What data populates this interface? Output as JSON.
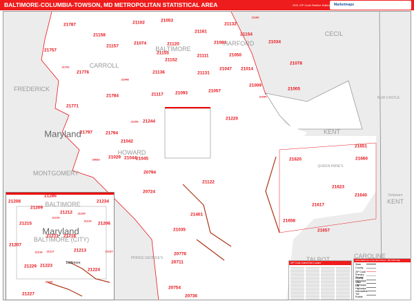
{
  "header": {
    "title": "BALTIMORE-COLUMBIA-TOWSON, MD METROPOLITAN STATISTICAL AREA",
    "edition": "2021 ZIP Code Redline Edition",
    "logo": "Marketmaps"
  },
  "colors": {
    "header": "#ee1c1c",
    "zip": "#e8141b",
    "outside_land": "#ececec"
  },
  "regions": [
    "CARROLL",
    "BALTIMORE",
    "HARFORD",
    "FREDERICK",
    "CECIL",
    "Maryland",
    "MONTGOMERY",
    "HOWARD",
    "KENT",
    "QUEEN ANNE'S",
    "NEW CASTLE",
    "Delaware",
    "KENT",
    "PRINCE GEORGE'S",
    "TALBOT",
    "CAROLINE"
  ],
  "zips": [
    "21787",
    "21158",
    "21102",
    "21053",
    "21161",
    "21132",
    "21160",
    "21154",
    "21757",
    "21157",
    "21074",
    "21120",
    "21084",
    "21034",
    "21155",
    "21152",
    "21111",
    "21050",
    "21791",
    "21776",
    "21136",
    "21131",
    "21047",
    "21014",
    "21078",
    "21048",
    "21784",
    "21117",
    "21093",
    "21057",
    "21009",
    "21005",
    "21040",
    "21771",
    "21244",
    "21153",
    "21797",
    "21794",
    "21042",
    "21029",
    "21044",
    "21045",
    "20833",
    "20794",
    "21220",
    "21122",
    "21651",
    "21660",
    "21620",
    "21623",
    "21640",
    "21617",
    "21658",
    "21657",
    "21401",
    "21035",
    "20776",
    "20711",
    "20724",
    "20754",
    "20736"
  ],
  "inset": {
    "regions": [
      "BALTIMORE",
      "Maryland",
      "BALTIMORE (CITY)",
      "Baltimore"
    ],
    "zips": [
      "21286",
      "21208",
      "21234",
      "21209",
      "21212",
      "21239",
      "21210",
      "21215",
      "21214",
      "21206",
      "21211",
      "21218",
      "21207",
      "21216",
      "21217",
      "21213",
      "21237",
      "21229",
      "21223",
      "21224",
      "21227",
      "21230"
    ]
  },
  "index": {
    "title": "ZIP Code Index/Grid Locator"
  },
  "legend": {
    "title": "2021 Baltimore-Columbia-Towson, MD MSA Map",
    "items": [
      "State",
      "County",
      "ZIP Code",
      "Primary Streets",
      "County Highways",
      "State Highways",
      "US Highways",
      "Interstates",
      "Toll Roads"
    ],
    "cities": "Cities and Towns"
  }
}
